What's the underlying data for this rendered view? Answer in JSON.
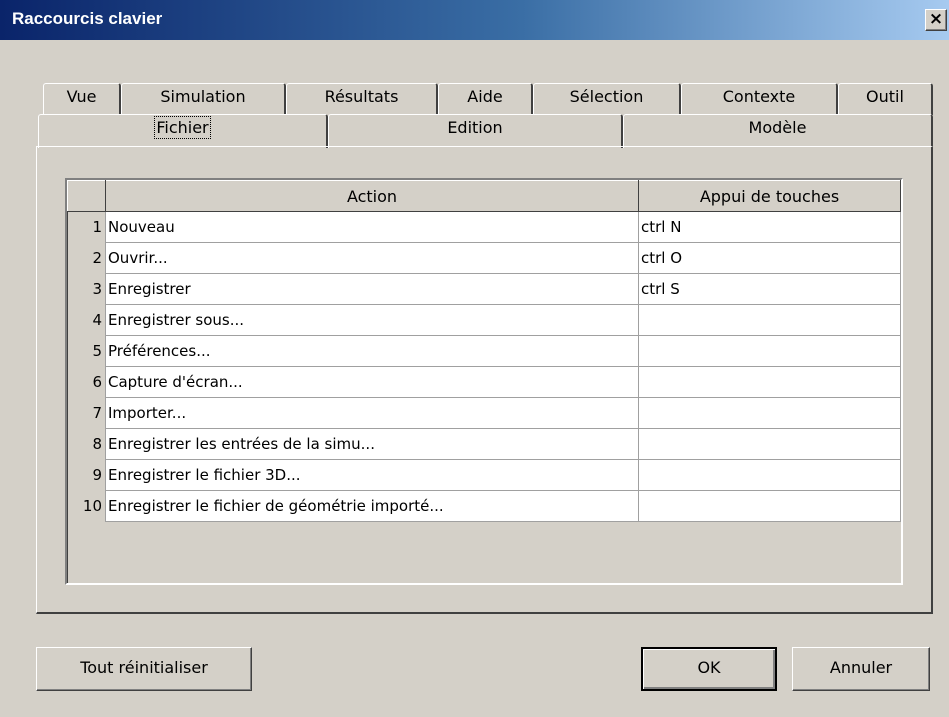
{
  "window": {
    "title": "Raccourcis clavier",
    "close_glyph": "×"
  },
  "tabs": {
    "back_row": [
      "Vue",
      "Simulation",
      "Résultats",
      "Aide",
      "Sélection",
      "Contexte",
      "Outil"
    ],
    "front_row": [
      "Fichier",
      "Edition",
      "Modèle"
    ],
    "selected": "Fichier"
  },
  "table": {
    "headers": {
      "action": "Action",
      "keys": "Appui de touches"
    },
    "rows": [
      {
        "num": "1",
        "action": "Nouveau",
        "keys": "ctrl N"
      },
      {
        "num": "2",
        "action": "Ouvrir...",
        "keys": "ctrl O"
      },
      {
        "num": "3",
        "action": "Enregistrer",
        "keys": "ctrl S"
      },
      {
        "num": "4",
        "action": "Enregistrer sous...",
        "keys": ""
      },
      {
        "num": "5",
        "action": "Préférences...",
        "keys": ""
      },
      {
        "num": "6",
        "action": "Capture d'écran...",
        "keys": ""
      },
      {
        "num": "7",
        "action": "Importer...",
        "keys": ""
      },
      {
        "num": "8",
        "action": "Enregistrer les entrées de la simu...",
        "keys": ""
      },
      {
        "num": "9",
        "action": "Enregistrer le fichier 3D...",
        "keys": ""
      },
      {
        "num": "10",
        "action": "Enregistrer le fichier de géométrie importé...",
        "keys": ""
      }
    ]
  },
  "buttons": {
    "reset": "Tout réinitialiser",
    "ok": "OK",
    "cancel": "Annuler"
  }
}
